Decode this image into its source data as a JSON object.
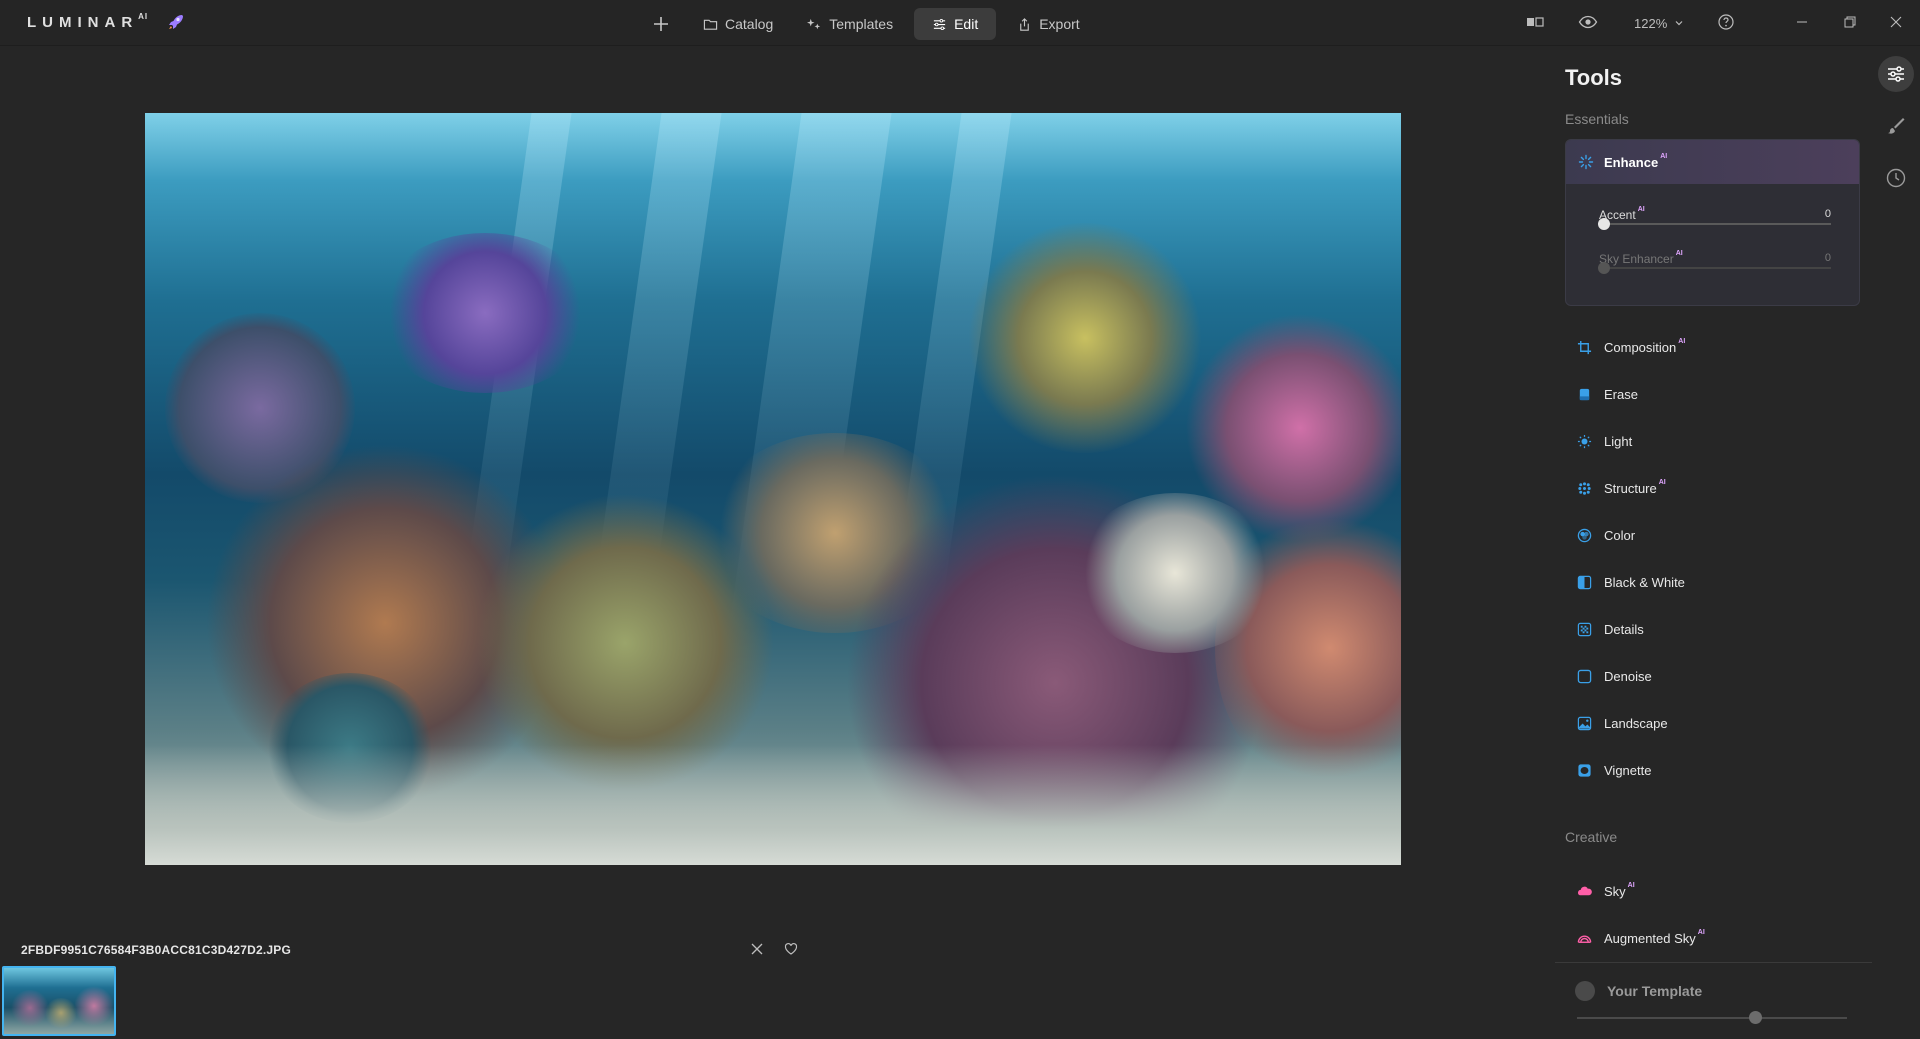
{
  "app": {
    "logo": "LUMINAR",
    "logo_sup": "AI"
  },
  "nav": {
    "catalog": "Catalog",
    "templates": "Templates",
    "edit": "Edit",
    "export": "Export"
  },
  "toolbar": {
    "zoom": "122%"
  },
  "filmstrip": {
    "filename": "2FBDF9951C76584F3B0ACC81C3D427D2.JPG"
  },
  "panel": {
    "title": "Tools",
    "essentials_label": "Essentials",
    "creative_label": "Creative",
    "enhance": {
      "label": "Enhance",
      "accent_label": "Accent",
      "accent_value": "0",
      "accent_level": 0,
      "sky_enhancer_label": "Sky Enhancer",
      "sky_enhancer_value": "0",
      "sky_enhancer_level": 0
    },
    "tools": [
      {
        "label": "Composition",
        "ai": true
      },
      {
        "label": "Erase",
        "ai": false
      },
      {
        "label": "Light",
        "ai": false
      },
      {
        "label": "Structure",
        "ai": true
      },
      {
        "label": "Color",
        "ai": false
      },
      {
        "label": "Black & White",
        "ai": false
      },
      {
        "label": "Details",
        "ai": false
      },
      {
        "label": "Denoise",
        "ai": false
      },
      {
        "label": "Landscape",
        "ai": false
      },
      {
        "label": "Vignette",
        "ai": false
      }
    ],
    "creative_tools": [
      {
        "label": "Sky",
        "ai": true
      },
      {
        "label": "Augmented Sky",
        "ai": true
      }
    ],
    "ai_badge": "AI",
    "template_label": "Your Template",
    "template_level": 0.67
  },
  "colors": {
    "accent": "#3aa0e8",
    "creative_pink": "#ff5fa8",
    "enhance_header": "#4c3f5b",
    "thumb_border": "#44b4f0"
  }
}
